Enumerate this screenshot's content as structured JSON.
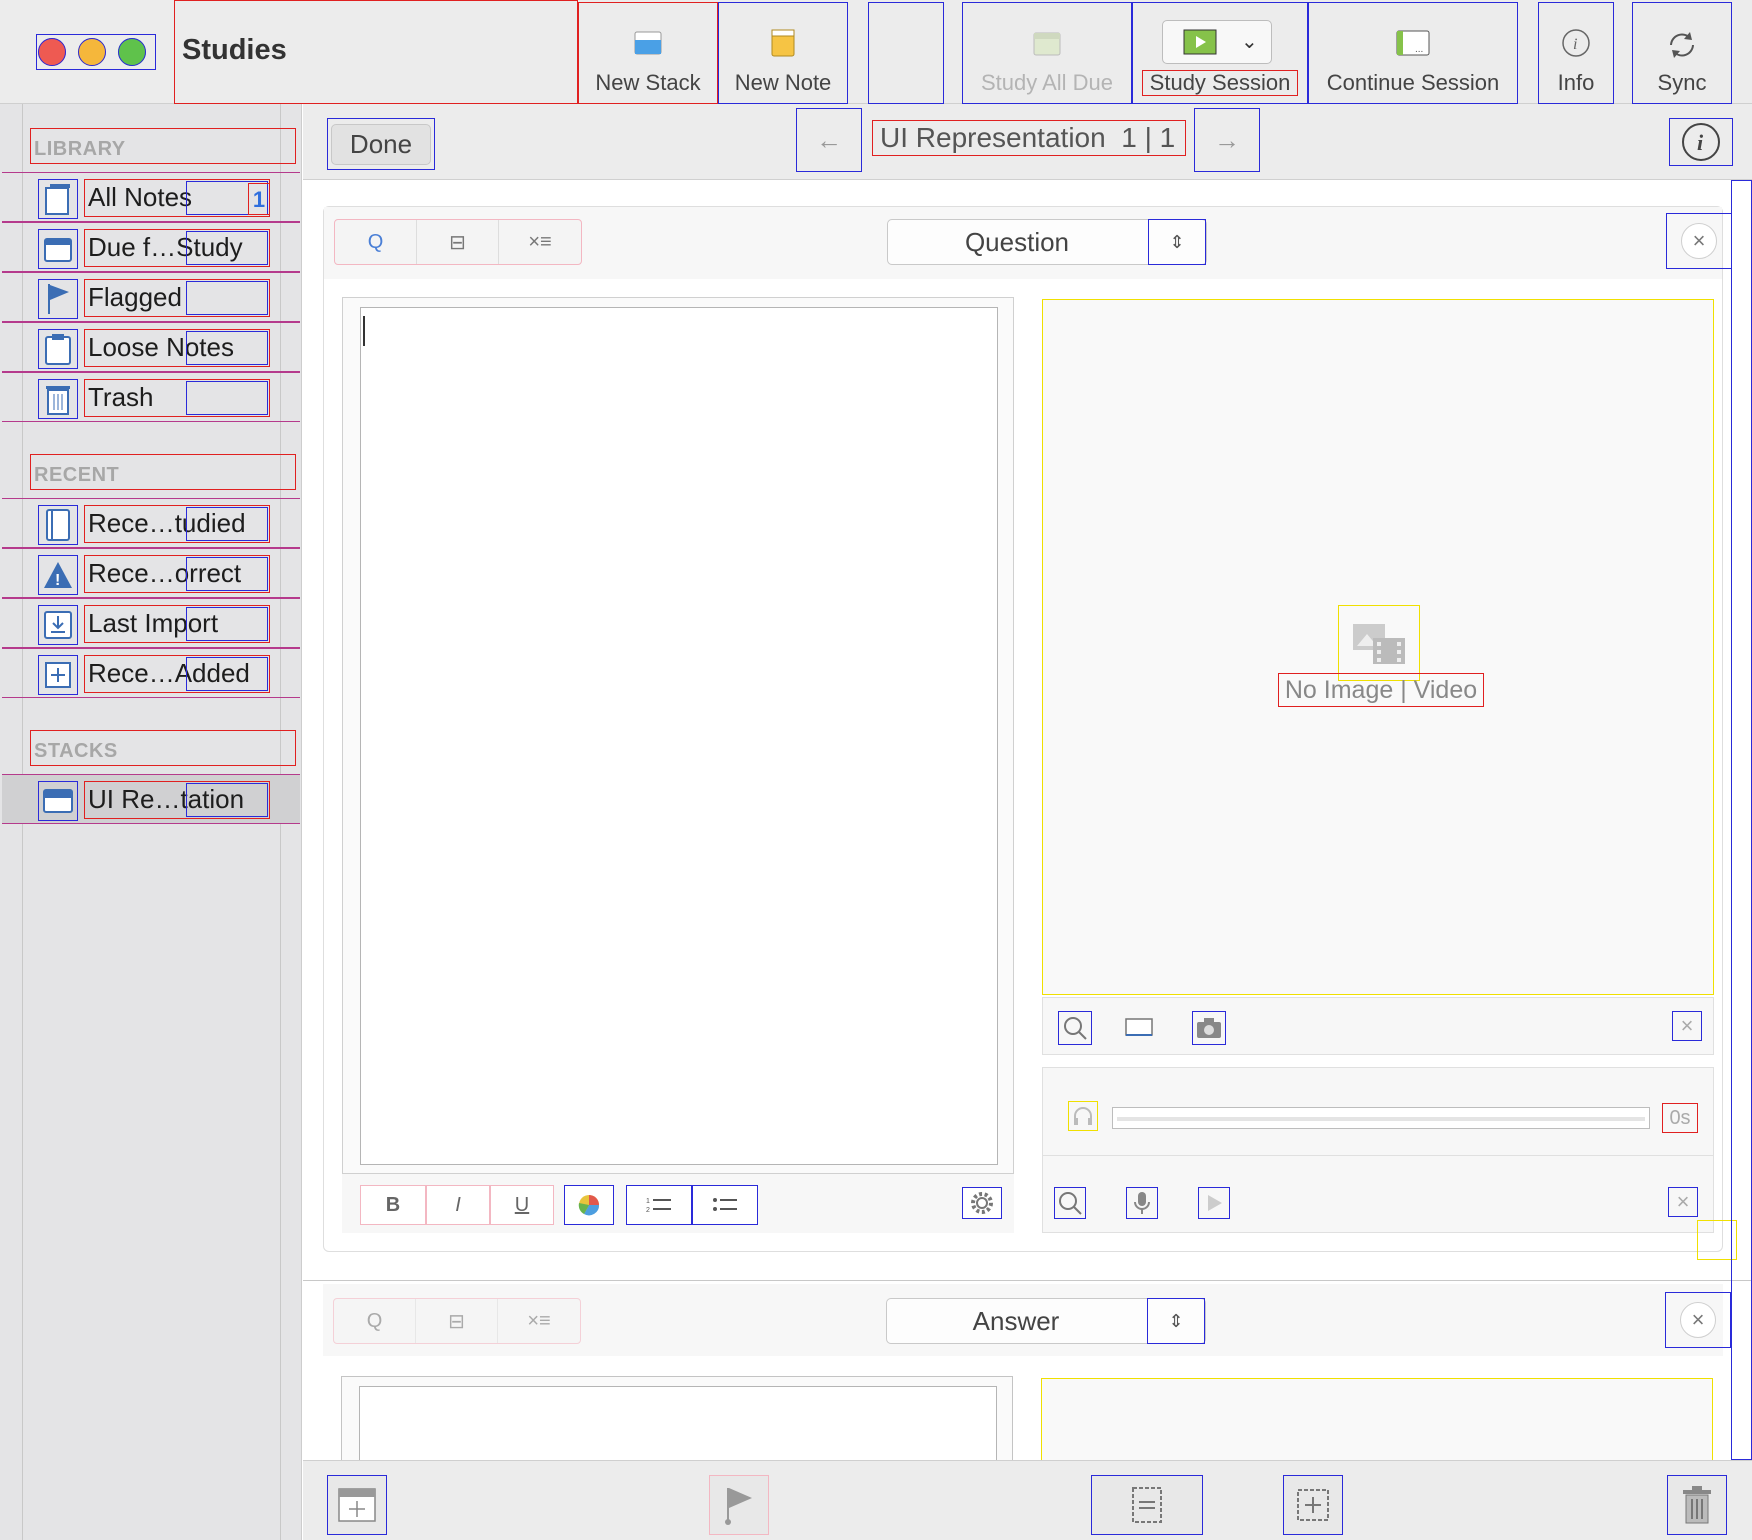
{
  "window": {
    "title": "Studies"
  },
  "toolbar": {
    "new_stack": "New Stack",
    "new_note": "New Note",
    "study_all_due": "Study All Due",
    "study_session": "Study Session",
    "continue_session": "Continue Session",
    "info": "Info",
    "sync": "Sync"
  },
  "sidebar": {
    "library_header": "LIBRARY",
    "library_items": [
      {
        "label": "All Notes",
        "count": "1",
        "icon": "notes-icon"
      },
      {
        "label": "Due f…Study",
        "icon": "calendar-icon"
      },
      {
        "label": "Flagged",
        "icon": "flag-icon"
      },
      {
        "label": "Loose Notes",
        "icon": "clipboard-icon"
      },
      {
        "label": "Trash",
        "icon": "trash-icon"
      }
    ],
    "recent_header": "RECENT",
    "recent_items": [
      {
        "label": "Rece…tudied",
        "icon": "book-icon"
      },
      {
        "label": "Rece…orrect",
        "icon": "warning-icon"
      },
      {
        "label": "Last Import",
        "icon": "import-icon"
      },
      {
        "label": "Rece…Added",
        "icon": "add-icon"
      }
    ],
    "stacks_header": "STACKS",
    "stack_items": [
      {
        "label": "UI Re…tation",
        "icon": "stack-icon"
      }
    ]
  },
  "navbar": {
    "done_label": "Done",
    "title": "UI Representation  1 | 1",
    "prev_arrow": "←",
    "next_arrow": "→"
  },
  "question_card": {
    "side_label": "Question",
    "media_placeholder": "No Image | Video",
    "audio_duration": "0s"
  },
  "answer_card": {
    "side_label": "Answer"
  },
  "colors": {
    "close": "#ee5a52",
    "minimize": "#f5b73b",
    "zoom": "#5fc24b",
    "accent": "#2f6fde"
  }
}
